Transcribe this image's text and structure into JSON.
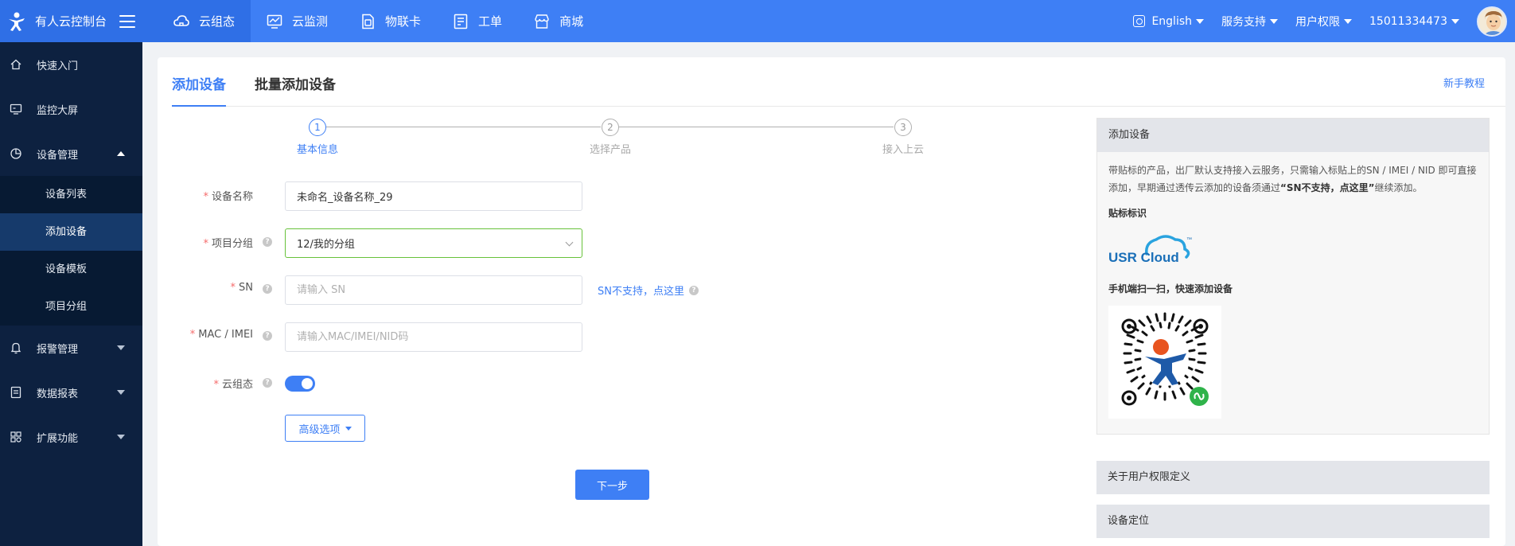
{
  "brand": {
    "title": "有人云控制台"
  },
  "topnav": [
    {
      "label": "云组态",
      "icon": "cloud-icon"
    },
    {
      "label": "云监测",
      "icon": "monitor-chart-icon"
    },
    {
      "label": "物联卡",
      "icon": "sim-card-icon"
    },
    {
      "label": "工单",
      "icon": "ticket-icon"
    },
    {
      "label": "商城",
      "icon": "store-icon"
    }
  ],
  "topright": {
    "language": "English",
    "support": "服务支持",
    "permissions": "用户权限",
    "account": "15011334473"
  },
  "sidebar": {
    "quickstart": "快速入门",
    "bigscreen": "监控大屏",
    "device_mgmt": "设备管理",
    "sub": [
      "设备列表",
      "添加设备",
      "设备模板",
      "项目分组"
    ],
    "alarm": "报警管理",
    "report": "数据报表",
    "extend": "扩展功能"
  },
  "tabs": {
    "add": "添加设备",
    "batch": "批量添加设备",
    "tutorial": "新手教程"
  },
  "steps": [
    "基本信息",
    "选择产品",
    "接入上云"
  ],
  "form": {
    "name_label": "设备名称",
    "name_value": "未命名_设备名称_29",
    "group_label": "项目分组",
    "group_value": "12/我的分组",
    "sn_label": "SN",
    "sn_placeholder": "请输入 SN",
    "sn_link": "SN不支持，点这里",
    "mac_label": "MAC / IMEI",
    "mac_placeholder": "请输入MAC/IMEI/NID码",
    "cloud_label": "云组态",
    "cloud_enabled": true,
    "advanced": "高级选项",
    "next": "下一步"
  },
  "panel": {
    "title": "添加设备",
    "desc_1": "带贴标的产品，出厂默认支持接入云服务，只需输入标贴上的SN / IMEI / NID 即可直接添加，早期通过透传云添加的设备须通过",
    "desc_bold": "“SN不支持，点这里”",
    "desc_2": "继续添加。",
    "label_title": "贴标标识",
    "logo_text": "USR Cloud",
    "logo_tm": "™",
    "scan_title": "手机端扫一扫，快速添加设备",
    "perm_title": "关于用户权限定义",
    "locate_title": "设备定位"
  },
  "colors": {
    "primary": "#3e7ff5",
    "sidebar": "#0d2140",
    "success_border": "#67c23a"
  }
}
